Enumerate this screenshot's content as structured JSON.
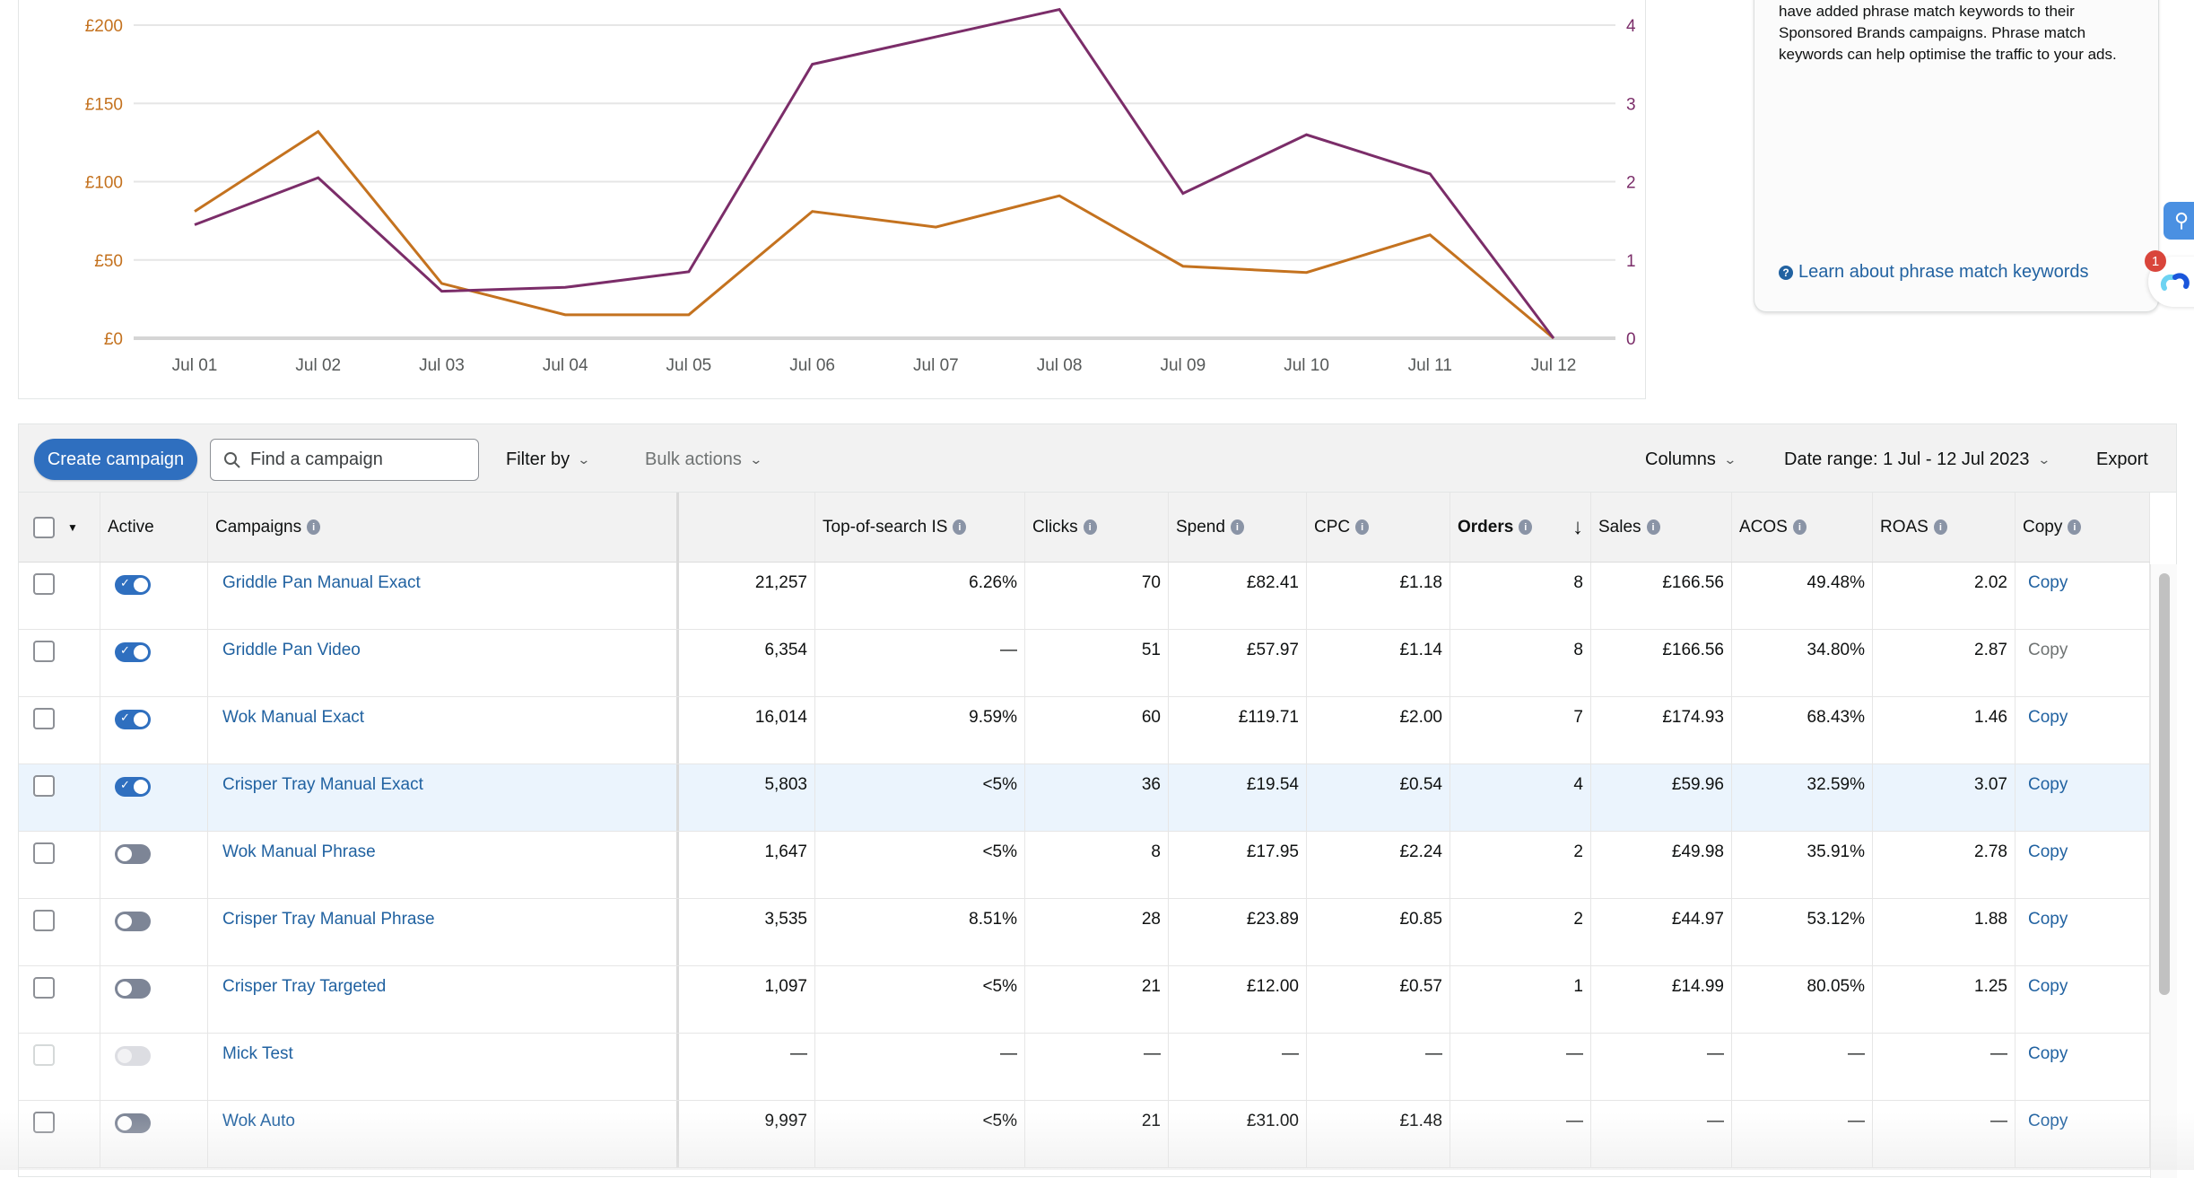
{
  "chart_data": {
    "type": "line",
    "x": [
      "Jul 01",
      "Jul 02",
      "Jul 03",
      "Jul 04",
      "Jul 05",
      "Jul 06",
      "Jul 07",
      "Jul 08",
      "Jul 09",
      "Jul 10",
      "Jul 11",
      "Jul 12"
    ],
    "series": [
      {
        "name": "Spend",
        "axis": "left",
        "color": "#c4721f",
        "values": [
          81,
          132,
          35,
          15,
          15,
          81,
          71,
          91,
          46,
          42,
          66,
          0
        ]
      },
      {
        "name": "Orders",
        "axis": "right",
        "color": "#7b2d69",
        "values": [
          1.45,
          2.05,
          0.6,
          0.65,
          0.85,
          3.5,
          3.85,
          4.2,
          1.85,
          2.6,
          2.1,
          0
        ]
      }
    ],
    "left_axis": {
      "ticks": [
        "£0",
        "£50",
        "£100",
        "£150",
        "£200"
      ],
      "range": [
        0,
        200
      ]
    },
    "right_axis": {
      "ticks": [
        "0",
        "1",
        "2",
        "3",
        "4"
      ],
      "range": [
        0,
        4
      ]
    },
    "grid": true,
    "title": "",
    "xlabel": "",
    "ylabel": ""
  },
  "info_card": {
    "text": "have added phrase match keywords to their Sponsored Brands campaigns. Phrase match keywords can help optimise the traffic to your ads.",
    "link_label": "Learn about phrase match keywords",
    "link_icon": "help-circle-icon"
  },
  "widgets": {
    "badge_count": "1"
  },
  "toolbar": {
    "create_label": "Create campaign",
    "search_placeholder": "Find a campaign",
    "filter_label": "Filter by",
    "bulk_label": "Bulk actions",
    "columns_label": "Columns",
    "date_range_label": "Date range: 1 Jul - 12 Jul 2023",
    "export_label": "Export"
  },
  "table": {
    "headers": {
      "active": "Active",
      "campaigns": "Campaigns",
      "impressions": "",
      "tos": "Top-of-search IS",
      "clicks": "Clicks",
      "spend": "Spend",
      "cpc": "CPC",
      "orders": "Orders",
      "sales": "Sales",
      "acos": "ACOS",
      "roas": "ROAS",
      "copy": "Copy"
    },
    "sort": {
      "column": "Orders",
      "direction": "descending"
    },
    "rows": [
      {
        "active": "on",
        "name": "Griddle Pan Manual Exact",
        "impressions": "21,257",
        "tos": "6.26%",
        "clicks": "70",
        "spend": "£82.41",
        "cpc": "£1.18",
        "orders": "8",
        "sales": "£166.56",
        "acos": "49.48%",
        "roas": "2.02",
        "copy": "Copy",
        "copy_enabled": true,
        "highlight": false
      },
      {
        "active": "on",
        "name": "Griddle Pan Video",
        "impressions": "6,354",
        "tos": "—",
        "clicks": "51",
        "spend": "£57.97",
        "cpc": "£1.14",
        "orders": "8",
        "sales": "£166.56",
        "acos": "34.80%",
        "roas": "2.87",
        "copy": "Copy",
        "copy_enabled": false,
        "highlight": false
      },
      {
        "active": "on",
        "name": "Wok Manual Exact",
        "impressions": "16,014",
        "tos": "9.59%",
        "clicks": "60",
        "spend": "£119.71",
        "cpc": "£2.00",
        "orders": "7",
        "sales": "£174.93",
        "acos": "68.43%",
        "roas": "1.46",
        "copy": "Copy",
        "copy_enabled": true,
        "highlight": false
      },
      {
        "active": "on",
        "name": "Crisper Tray Manual Exact",
        "impressions": "5,803",
        "tos": "<5%",
        "clicks": "36",
        "spend": "£19.54",
        "cpc": "£0.54",
        "orders": "4",
        "sales": "£59.96",
        "acos": "32.59%",
        "roas": "3.07",
        "copy": "Copy",
        "copy_enabled": true,
        "highlight": true
      },
      {
        "active": "off",
        "name": "Wok Manual Phrase",
        "impressions": "1,647",
        "tos": "<5%",
        "clicks": "8",
        "spend": "£17.95",
        "cpc": "£2.24",
        "orders": "2",
        "sales": "£49.98",
        "acos": "35.91%",
        "roas": "2.78",
        "copy": "Copy",
        "copy_enabled": true,
        "highlight": false
      },
      {
        "active": "off",
        "name": "Crisper Tray Manual Phrase",
        "impressions": "3,535",
        "tos": "8.51%",
        "clicks": "28",
        "spend": "£23.89",
        "cpc": "£0.85",
        "orders": "2",
        "sales": "£44.97",
        "acos": "53.12%",
        "roas": "1.88",
        "copy": "Copy",
        "copy_enabled": true,
        "highlight": false
      },
      {
        "active": "off",
        "name": "Crisper Tray Targeted",
        "impressions": "1,097",
        "tos": "<5%",
        "clicks": "21",
        "spend": "£12.00",
        "cpc": "£0.57",
        "orders": "1",
        "sales": "£14.99",
        "acos": "80.05%",
        "roas": "1.25",
        "copy": "Copy",
        "copy_enabled": true,
        "highlight": false
      },
      {
        "active": "disabled",
        "name": "Mick Test",
        "impressions": "—",
        "tos": "—",
        "clicks": "—",
        "spend": "—",
        "cpc": "—",
        "orders": "—",
        "sales": "—",
        "acos": "—",
        "roas": "—",
        "copy": "Copy",
        "copy_enabled": true,
        "highlight": false
      },
      {
        "active": "off",
        "name": "Wok Auto",
        "impressions": "9,997",
        "tos": "<5%",
        "clicks": "21",
        "spend": "£31.00",
        "cpc": "£1.48",
        "orders": "—",
        "sales": "—",
        "acos": "—",
        "roas": "—",
        "copy": "Copy",
        "copy_enabled": true,
        "highlight": false
      }
    ]
  }
}
